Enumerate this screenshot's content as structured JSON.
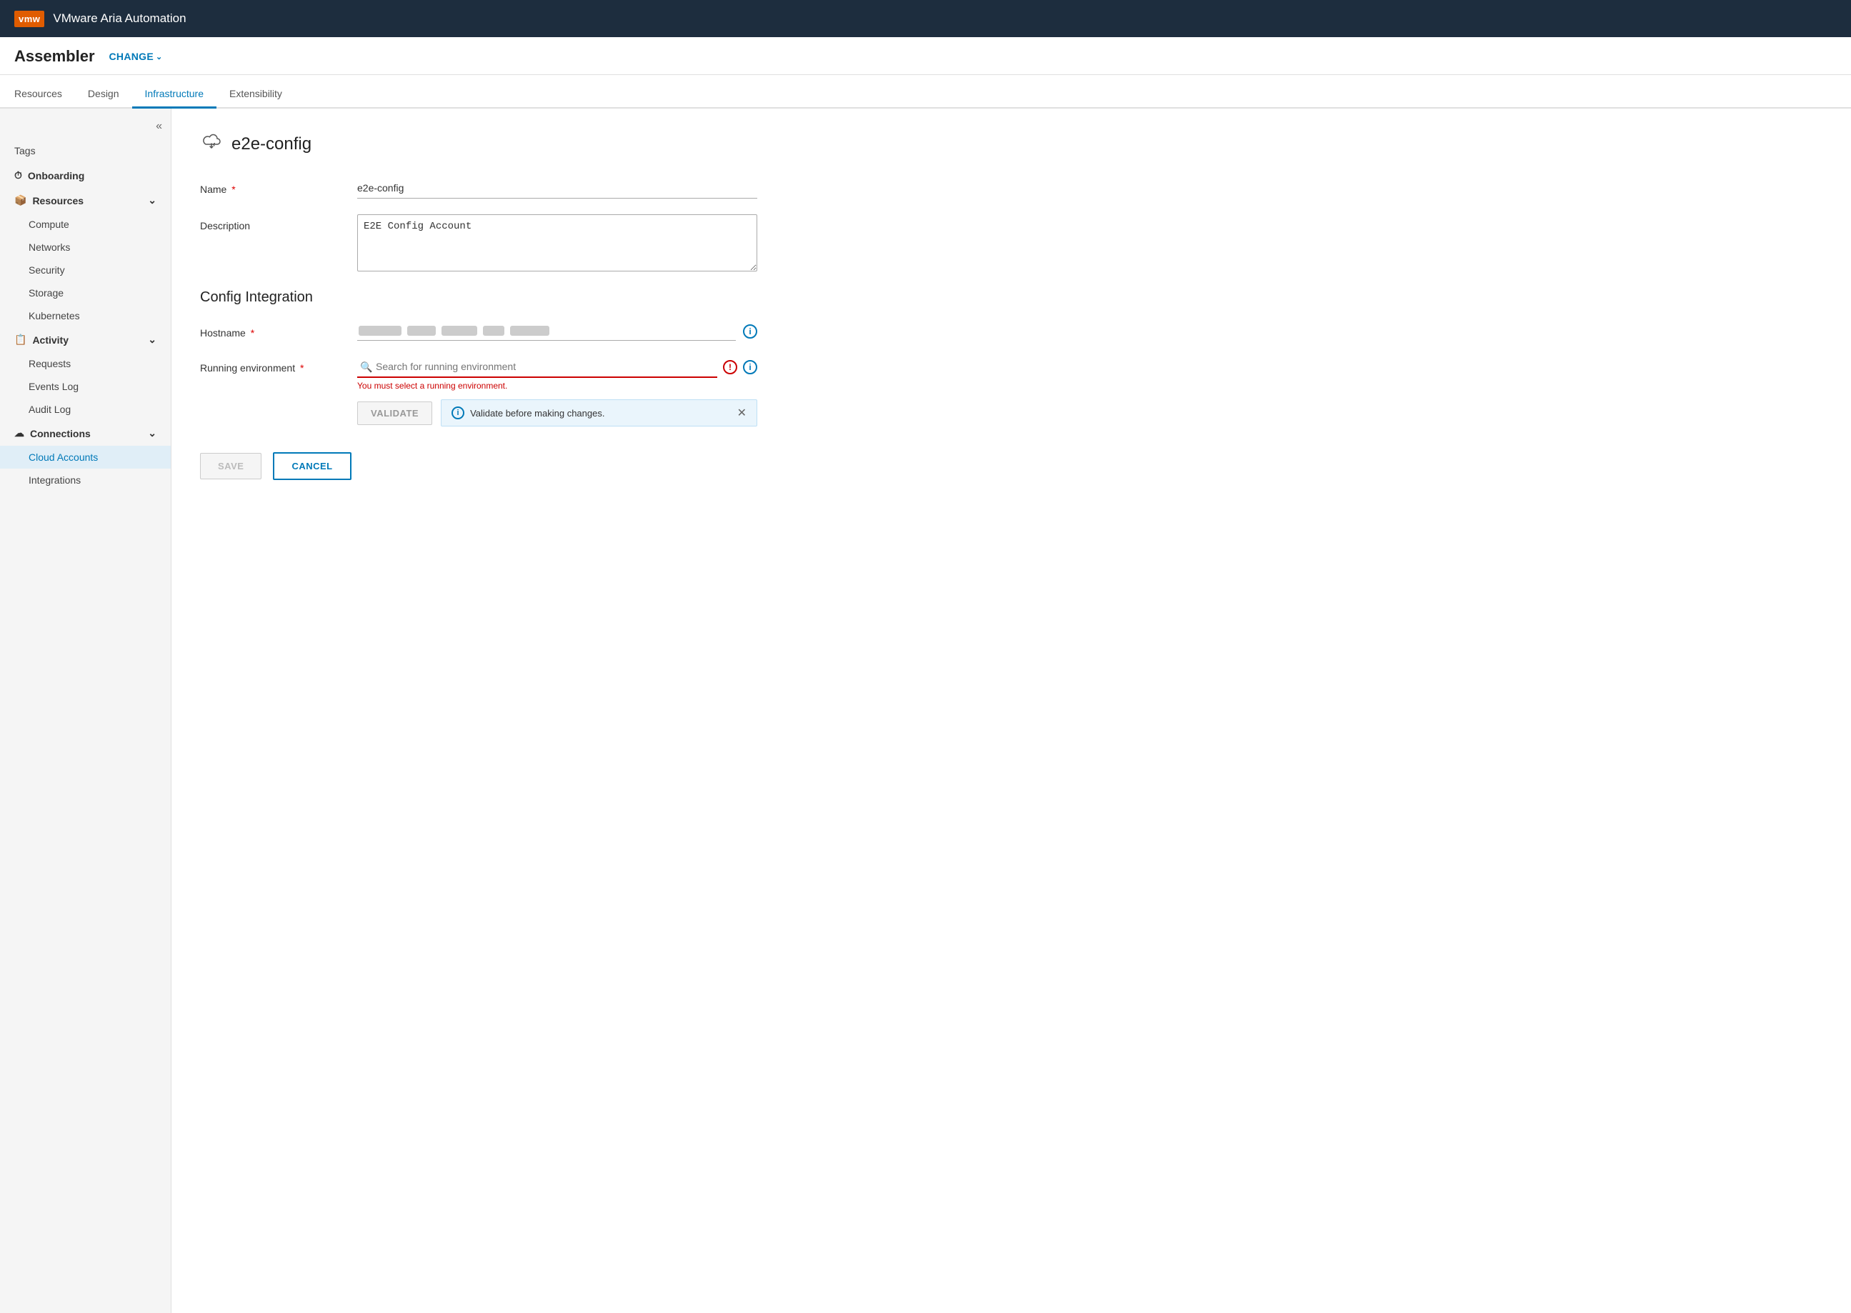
{
  "topbar": {
    "logo": "vmw",
    "app_title": "VMware Aria Automation"
  },
  "subheader": {
    "assembler_label": "Assembler",
    "change_label": "CHANGE"
  },
  "tabs": [
    {
      "id": "resources",
      "label": "Resources",
      "active": false
    },
    {
      "id": "design",
      "label": "Design",
      "active": false
    },
    {
      "id": "infrastructure",
      "label": "Infrastructure",
      "active": true
    },
    {
      "id": "extensibility",
      "label": "Extensibility",
      "active": false
    }
  ],
  "sidebar": {
    "collapse_tooltip": "Collapse sidebar",
    "items": [
      {
        "id": "tags",
        "label": "Tags",
        "type": "item",
        "icon": ""
      },
      {
        "id": "onboarding",
        "label": "Onboarding",
        "type": "group-header",
        "icon": "⏱"
      },
      {
        "id": "resources",
        "label": "Resources",
        "type": "group-header",
        "icon": "📦",
        "expanded": true
      },
      {
        "id": "compute",
        "label": "Compute",
        "type": "sub-item"
      },
      {
        "id": "networks",
        "label": "Networks",
        "type": "sub-item"
      },
      {
        "id": "security",
        "label": "Security",
        "type": "sub-item"
      },
      {
        "id": "storage",
        "label": "Storage",
        "type": "sub-item"
      },
      {
        "id": "kubernetes",
        "label": "Kubernetes",
        "type": "sub-item"
      },
      {
        "id": "activity",
        "label": "Activity",
        "type": "group-header",
        "icon": "📋",
        "expanded": true
      },
      {
        "id": "requests",
        "label": "Requests",
        "type": "sub-item"
      },
      {
        "id": "events-log",
        "label": "Events Log",
        "type": "sub-item"
      },
      {
        "id": "audit-log",
        "label": "Audit Log",
        "type": "sub-item"
      },
      {
        "id": "connections",
        "label": "Connections",
        "type": "group-header",
        "icon": "☁",
        "expanded": true
      },
      {
        "id": "cloud-accounts",
        "label": "Cloud Accounts",
        "type": "sub-item",
        "active": true
      },
      {
        "id": "integrations",
        "label": "Integrations",
        "type": "sub-item"
      }
    ]
  },
  "content": {
    "page_icon": "☁",
    "page_title": "e2e-config",
    "form": {
      "name_label": "Name",
      "name_value": "e2e-config",
      "name_placeholder": "e2e-config",
      "description_label": "Description",
      "description_value": "E2E Config Account",
      "section_title": "Config Integration",
      "hostname_label": "Hostname",
      "hostname_placeholder": "••••••••••••••••••••••••••",
      "running_env_label": "Running environment",
      "running_env_placeholder": "Search for running environment",
      "running_env_error": "You must select a running environment.",
      "validate_btn_label": "VALIDATE",
      "validate_notice_text": "Validate before making changes.",
      "save_btn_label": "SAVE",
      "cancel_btn_label": "CANCEL"
    }
  }
}
